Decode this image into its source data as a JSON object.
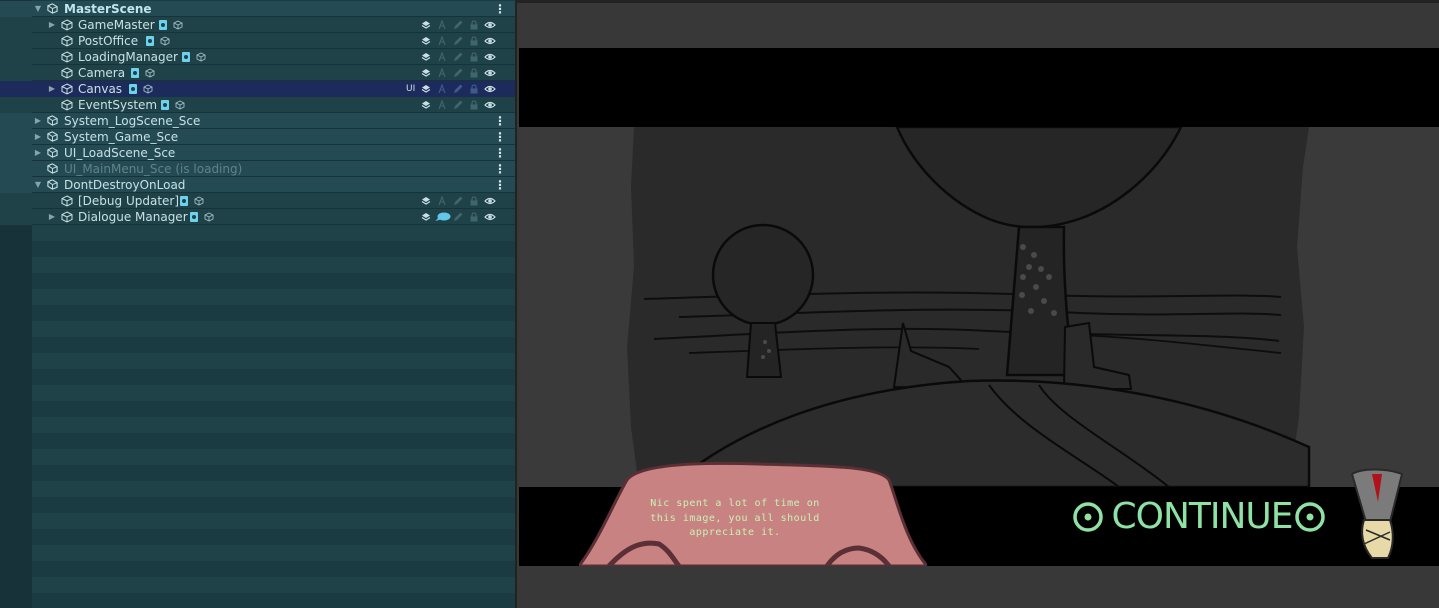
{
  "hierarchy": {
    "rows": [
      {
        "label": "MasterScene",
        "type": "scene",
        "expanded": true,
        "bold": true
      },
      {
        "label": "GameMaster",
        "type": "gameobject",
        "has_children": true
      },
      {
        "label": "PostOffice",
        "type": "gameobject"
      },
      {
        "label": "LoadingManager",
        "type": "gameobject"
      },
      {
        "label": "Camera",
        "type": "gameobject"
      },
      {
        "label": "Canvas",
        "type": "gameobject",
        "has_children": true,
        "selected": true,
        "layer_tag": "UI"
      },
      {
        "label": "EventSystem",
        "type": "gameobject"
      },
      {
        "label": "System_LogScene_Sce",
        "type": "scene",
        "expanded": false
      },
      {
        "label": "System_Game_Sce",
        "type": "scene",
        "expanded": false
      },
      {
        "label": "UI_LoadScene_Sce",
        "type": "scene",
        "expanded": false
      },
      {
        "label": "UI_MainMenu_Sce (is loading)",
        "type": "scene",
        "loading": true
      },
      {
        "label": "DontDestroyOnLoad",
        "type": "scene",
        "expanded": true
      },
      {
        "label": "[Debug Updater]",
        "type": "gameobject"
      },
      {
        "label": "Dialogue Manager",
        "type": "gameobject",
        "has_children": true
      }
    ]
  },
  "game_view": {
    "dialogue_text": "Nic spent a lot of time on this image, you all should appreciate it.",
    "continue_label": "CONTINUE"
  },
  "colors": {
    "panel_bg": "#1b3b42",
    "selected_row": "#1d2a5c",
    "accent_green": "#8ee3a4",
    "bubble_pink": "#c98282"
  },
  "icons": [
    "unity-scene-icon",
    "gameobject-cube-icon",
    "script-icon",
    "prefab-icon",
    "layers-icon",
    "lock-icon",
    "pencil-icon",
    "eye-icon",
    "kebab-menu-icon",
    "expand-arrow-icon"
  ]
}
